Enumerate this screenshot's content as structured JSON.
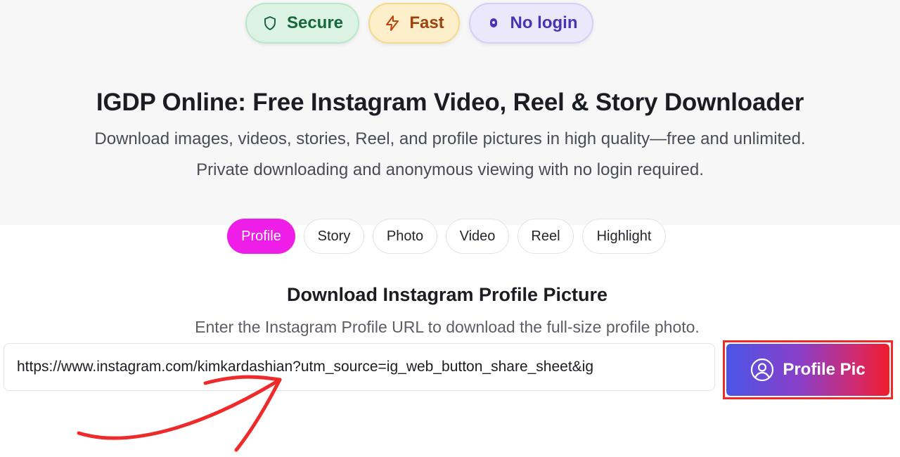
{
  "badges": [
    {
      "label": "Secure",
      "icon": "shield-icon",
      "color": "#15693a"
    },
    {
      "label": "Fast",
      "icon": "lightning-icon",
      "color": "#a0410e"
    },
    {
      "label": "No login",
      "icon": "lock-icon",
      "color": "#4a32b5"
    }
  ],
  "hero": {
    "title": "IGDP Online: Free Instagram Video, Reel & Story Downloader",
    "subtitle_line1": "Download images, videos, stories, Reel, and profile pictures in high quality—free and unlimited.",
    "subtitle_line2": "Private downloading and anonymous viewing with no login required."
  },
  "tabs": [
    {
      "label": "Profile",
      "active": true
    },
    {
      "label": "Story",
      "active": false
    },
    {
      "label": "Photo",
      "active": false
    },
    {
      "label": "Video",
      "active": false
    },
    {
      "label": "Reel",
      "active": false
    },
    {
      "label": "Highlight",
      "active": false
    }
  ],
  "section": {
    "title": "Download Instagram Profile Picture",
    "subtitle": "Enter the Instagram Profile URL to download the full-size profile photo."
  },
  "url_input": {
    "value": "https://www.instagram.com/kimkardashian?utm_source=ig_web_button_share_sheet&ig"
  },
  "submit_button": {
    "label": "Profile Pic",
    "icon": "user-circle-icon"
  },
  "colors": {
    "active_tab": "#ee1ee8",
    "button_gradient_start": "#4b55e6",
    "button_gradient_end": "#ef1c2b",
    "annotation": "#ee2a2a"
  }
}
